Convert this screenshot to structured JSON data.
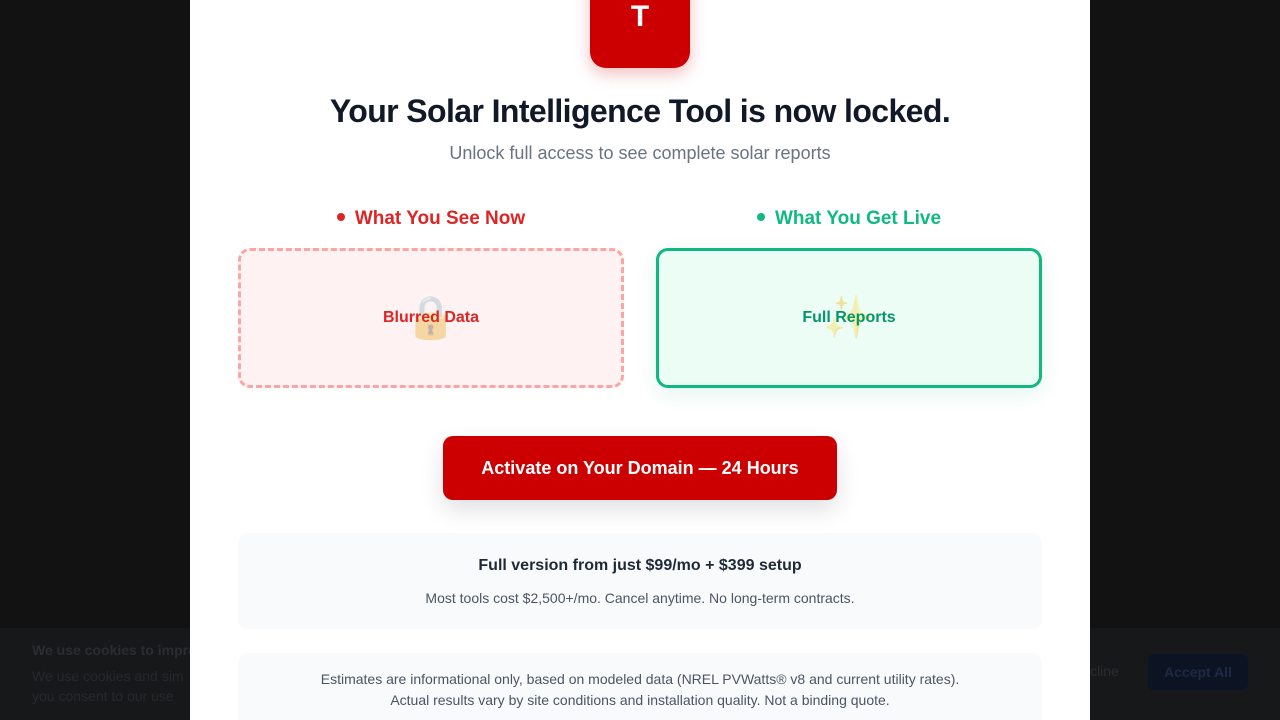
{
  "cookie": {
    "title": "We use cookies to impro",
    "text_line1": "We use cookies and sim",
    "text_line2": "you consent to our use",
    "decline_label": "cline",
    "accept_label": "Accept All"
  },
  "modal": {
    "logo_letter": "T",
    "title": "Your Solar Intelligence Tool is now locked.",
    "subtitle": "Unlock full access to see complete solar reports",
    "left_column": {
      "heading": "What You See Now",
      "card_icon": "🔒",
      "card_label": "Blurred Data"
    },
    "right_column": {
      "heading": "What You Get Live",
      "card_icon": "✨",
      "card_label": "Full Reports"
    },
    "cta_label": "Activate on Your Domain — 24 Hours",
    "pricing": {
      "main": "Full version from just $99/mo + $399 setup",
      "sub": "Most tools cost $2,500+/mo. Cancel anytime. No long-term contracts."
    },
    "disclaimer": {
      "line1": "Estimates are informational only, based on modeled data (NREL PVWatts® v8 and current utility rates).",
      "line2": "Actual results vary by site conditions and installation quality. Not a binding quote."
    }
  },
  "colors": {
    "brand_red": "#cc0000",
    "negative": "#dc2626",
    "positive": "#10b981",
    "title_text": "#111827"
  }
}
